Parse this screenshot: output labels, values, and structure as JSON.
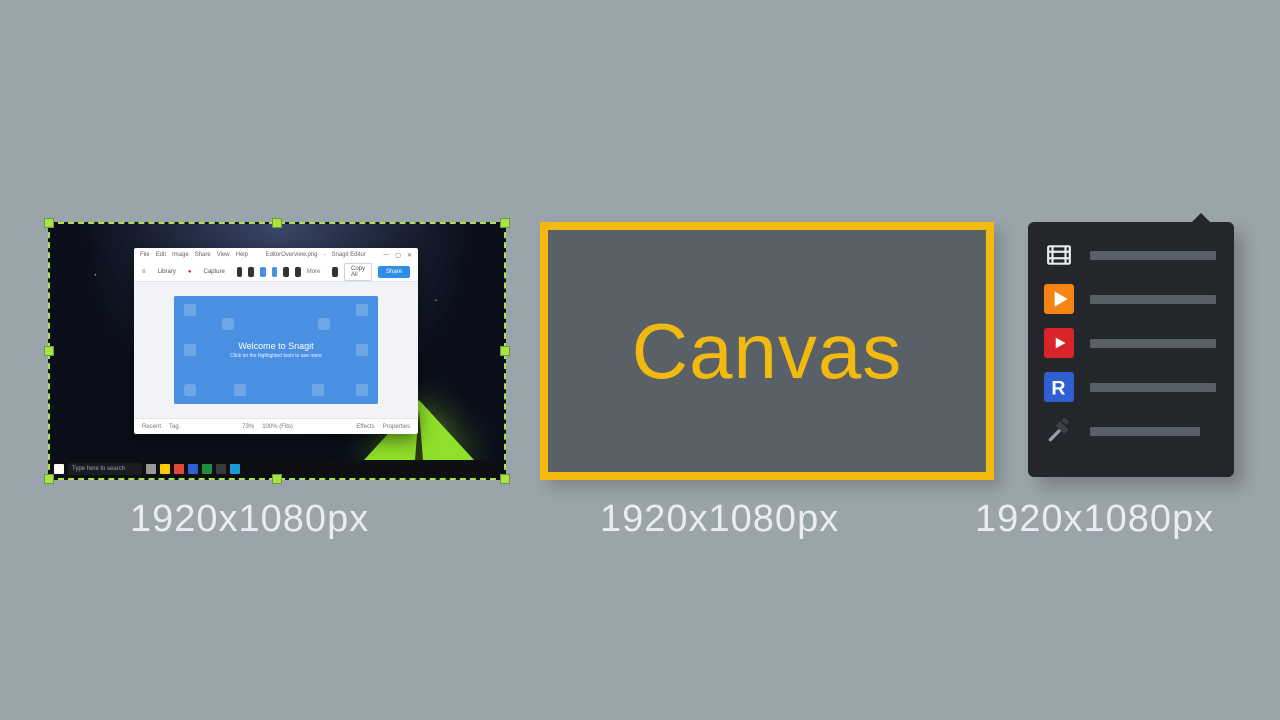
{
  "captions": {
    "panel1": "1920x1080px",
    "panel2": "1920x1080px",
    "panel3": "1920x1080px"
  },
  "panel2": {
    "label": "Canvas"
  },
  "screenshot": {
    "taskbar": {
      "search_placeholder": "Type here to search"
    },
    "editor": {
      "menu": {
        "file": "File",
        "edit": "Edit",
        "image": "Image",
        "share": "Share",
        "view": "View",
        "help": "Help"
      },
      "title_suffix": "Snagit Editor",
      "title_file": "EditorOverview.png",
      "toolbar": {
        "library": "Library",
        "capture": "Capture",
        "more": "More",
        "copy_all": "Copy All",
        "share": "Share"
      },
      "welcome": {
        "heading": "Welcome to Snagit",
        "sub": "Click on the highlighted tools to see more"
      },
      "status": {
        "recent": "Recent",
        "tag": "Tag",
        "zoom": "73%",
        "fit": "100% (Fits)",
        "effects": "Effects",
        "properties": "Properties"
      }
    }
  },
  "panel3": {
    "items": [
      {
        "icon": "film-icon",
        "label": ""
      },
      {
        "icon": "play-icon",
        "label": ""
      },
      {
        "icon": "youtube-icon",
        "label": ""
      },
      {
        "icon": "r-icon",
        "label": ""
      },
      {
        "icon": "tools-icon",
        "label": ""
      }
    ]
  }
}
